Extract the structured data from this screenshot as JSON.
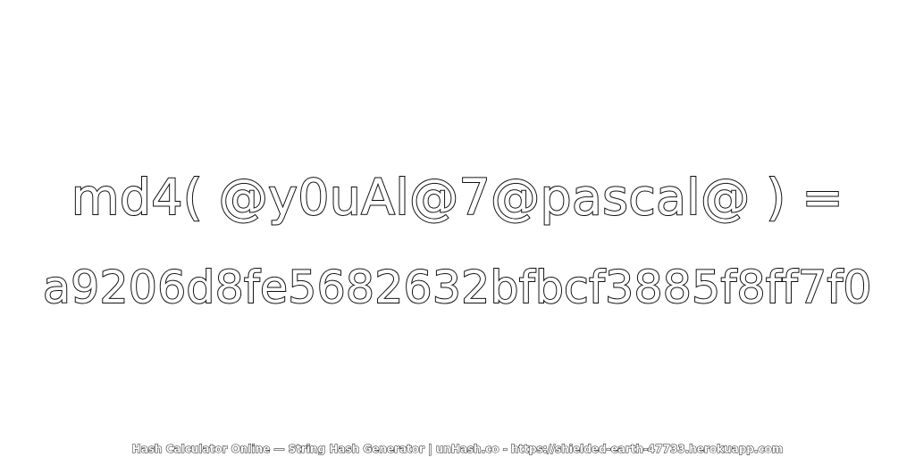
{
  "hash": {
    "expression": "md4( @y0uAl@7@pascal@ ) =",
    "result": "a9206d8fe5682632bfbcf3885f8ff7f0"
  },
  "footer": {
    "credit": "Hash Calculator Online — String Hash Generator | unHash.co - https://shielded-earth-47733.herokuapp.com"
  },
  "colors": {
    "background": "#ffffff",
    "text_fill": "#ffffff",
    "text_outline": "#111111"
  }
}
